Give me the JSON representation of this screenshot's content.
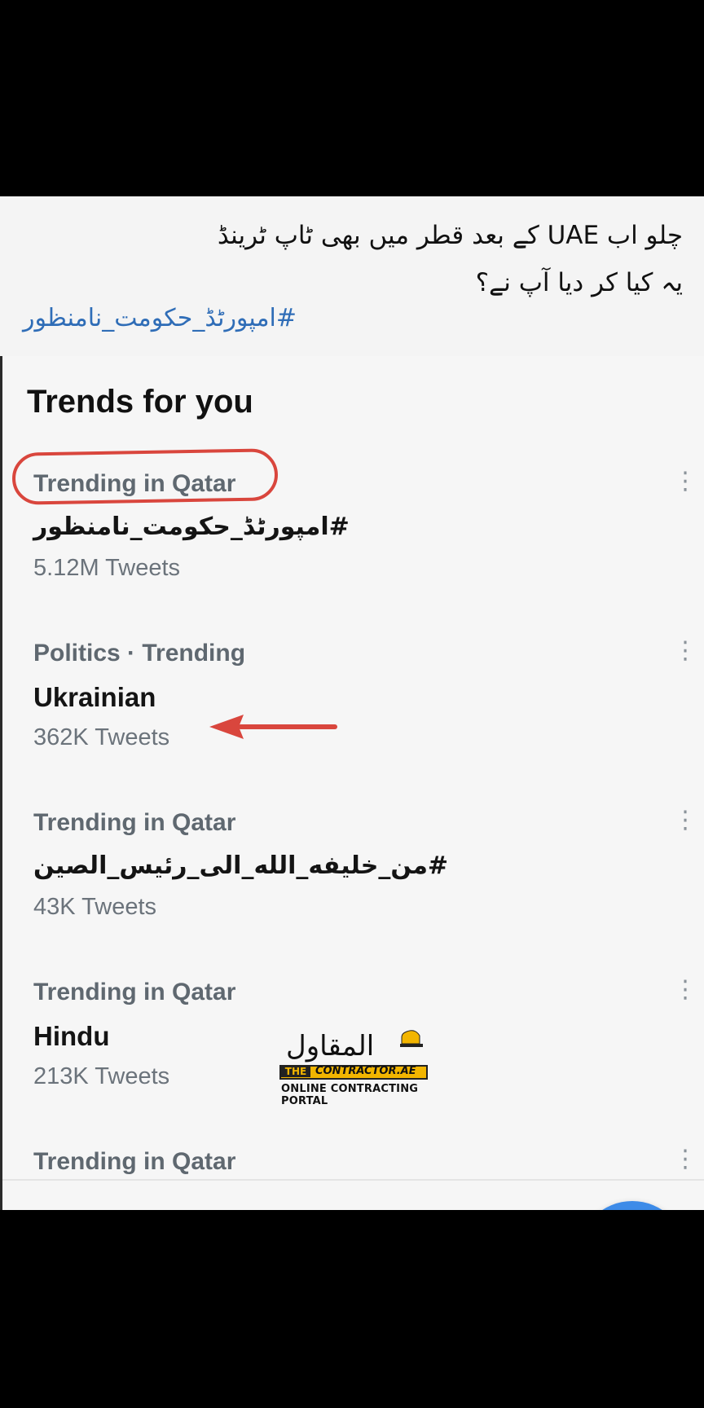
{
  "post": {
    "line1": "چلو اب UAE کے بعد قطر میں بھی ٹاپ ٹرینڈ",
    "line2": "یہ کیا کر دیا آپ نے؟",
    "hashtag": "#امپورٹڈ_حکومت_نامنظور"
  },
  "trends": {
    "title": "Trends for you",
    "items": [
      {
        "context": "Trending in Qatar",
        "name": "#امپورٹڈ_حکومت_نامنظور",
        "count": "5.12M Tweets"
      },
      {
        "context": "Politics · Trending",
        "name": "Ukrainian",
        "count": "362K Tweets"
      },
      {
        "context": "Trending in Qatar",
        "name": "#من_خليفه_الله_الی_رئيس_الصين",
        "count": "43K Tweets"
      },
      {
        "context": "Trending in Qatar",
        "name": "Hindu",
        "count": "213K Tweets"
      },
      {
        "context": "Trending in Qatar",
        "name": "",
        "count": ""
      }
    ],
    "more_icon": "three-dots-vertical-icon"
  },
  "fab": {
    "icon": "plus-icon",
    "label": "+",
    "color": "#3d8be8"
  },
  "watermark": {
    "arabic": "المقاول",
    "prefix": "THE",
    "domain": "CONTRACTOR.AE",
    "tagline": "ONLINE CONTRACTING PORTAL"
  },
  "annotation": {
    "circle_color": "#d9463d",
    "arrow_color": "#d9463d"
  }
}
